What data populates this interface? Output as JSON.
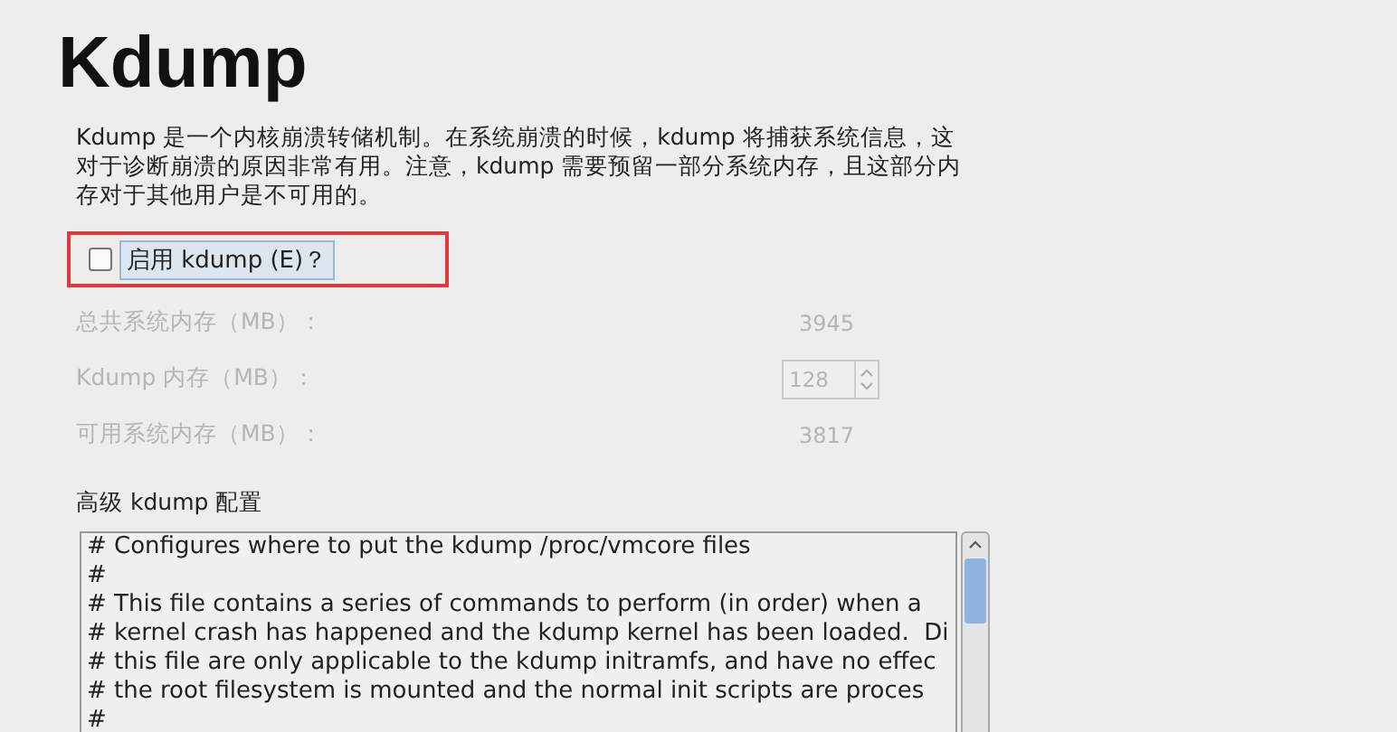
{
  "title": "Kdump",
  "description": "Kdump 是一个内核崩溃转储机制。在系统崩溃的时候，kdump 将捕获系统信息，这对于诊断崩溃的原因非常有用。注意，kdump 需要预留一部分系统内存，且这部分内存对于其他用户是不可用的。",
  "enable": {
    "label": "启用 kdump (E)？",
    "checked": false,
    "highlighted": true
  },
  "memory_rows": [
    {
      "kind": "value",
      "label": "总共系统内存（MB）：",
      "value": "3945",
      "disabled": true
    },
    {
      "kind": "spin",
      "label": "Kdump 内存（MB）：",
      "value": "128",
      "disabled": true
    },
    {
      "kind": "value",
      "label": "可用系统内存（MB）：",
      "value": "3817",
      "disabled": true
    }
  ],
  "advanced": {
    "label": "高级 kdump 配置",
    "lines": [
      "# Configures where to put the kdump /proc/vmcore files",
      "#",
      "# This file contains a series of commands to perform (in order) when a",
      "# kernel crash has happened and the kdump kernel has been loaded.  Di",
      "# this file are only applicable to the kdump initramfs, and have no effec",
      "# the root filesystem is mounted and the normal init scripts are proces",
      "#"
    ]
  }
}
